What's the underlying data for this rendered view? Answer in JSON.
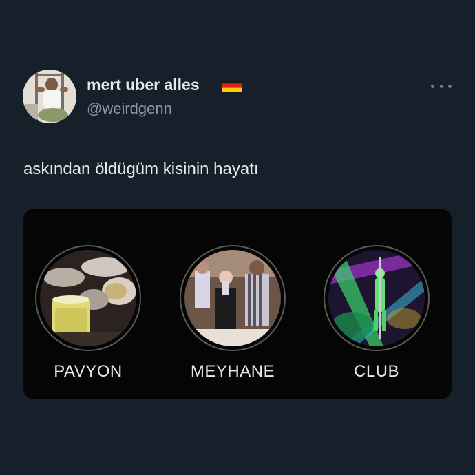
{
  "author": {
    "display_name": "mert uber alles",
    "handle": "@weirdgenn",
    "flag_icon": "germany-flag-icon"
  },
  "tweet": {
    "text": "askından öldügüm kisinin hayatı"
  },
  "media": {
    "highlights": [
      {
        "label": "PAVYON",
        "icon": "drinks-table-thumbnail"
      },
      {
        "label": "MEYHANE",
        "icon": "tavern-people-thumbnail"
      },
      {
        "label": "CLUB",
        "icon": "club-dancer-thumbnail"
      }
    ]
  },
  "colors": {
    "background": "#16202b",
    "text_primary": "#e7e9ea",
    "text_secondary": "#8b98a5",
    "media_background": "#050505"
  }
}
